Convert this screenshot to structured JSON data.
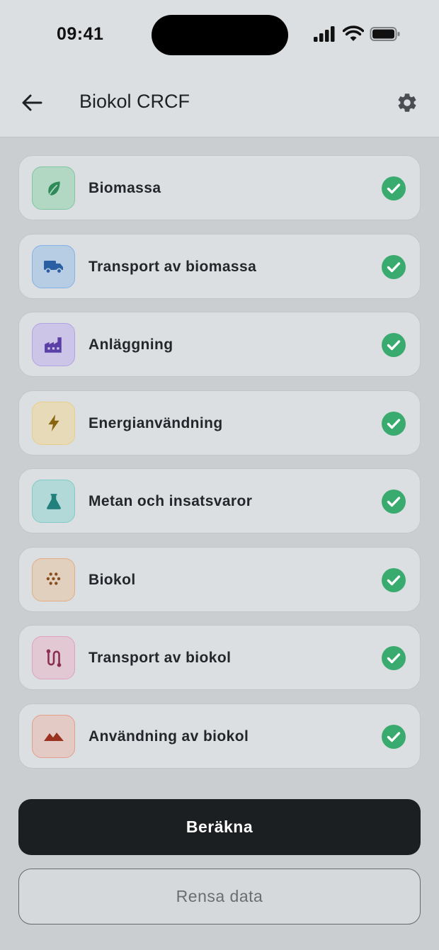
{
  "status_bar": {
    "time": "09:41"
  },
  "app_bar": {
    "title": "Biokol CRCF"
  },
  "colors": {
    "check": "#3aab6e",
    "primary_button": "#1c1f22"
  },
  "items": [
    {
      "label": "Biomassa",
      "icon": "leaf-icon",
      "bg": "#b2d8c4",
      "border": "#7fc6a0",
      "fg": "#2e8a57",
      "complete": true
    },
    {
      "label": "Transport av biomassa",
      "icon": "truck-icon",
      "bg": "#b7cde4",
      "border": "#84b2e6",
      "fg": "#2b5fa3",
      "complete": true
    },
    {
      "label": "Anläggning",
      "icon": "factory-icon",
      "bg": "#cdc5e8",
      "border": "#b1a2e4",
      "fg": "#5a3fa6",
      "complete": true
    },
    {
      "label": "Energianvändning",
      "icon": "lightning-icon",
      "bg": "#e6dab8",
      "border": "#e8cf86",
      "fg": "#8a6410",
      "complete": true
    },
    {
      "label": "Metan och insatsvaror",
      "icon": "flask-icon",
      "bg": "#b2d9d8",
      "border": "#7fcbc7",
      "fg": "#22807c",
      "complete": true
    },
    {
      "label": "Biokol",
      "icon": "biochar-dots-icon",
      "bg": "#e2d0be",
      "border": "#e3ac84",
      "fg": "#8a4b1d",
      "complete": true
    },
    {
      "label": "Transport av biokol",
      "icon": "route-icon",
      "bg": "#e1c8d3",
      "border": "#dfa3bf",
      "fg": "#8c2e52",
      "complete": true
    },
    {
      "label": "Användning av biokol",
      "icon": "soil-mounds-icon",
      "bg": "#e4cac4",
      "border": "#e39e8c",
      "fg": "#9a3220",
      "complete": true
    }
  ],
  "actions": {
    "calculate_label": "Beräkna",
    "clear_label": "Rensa data"
  }
}
